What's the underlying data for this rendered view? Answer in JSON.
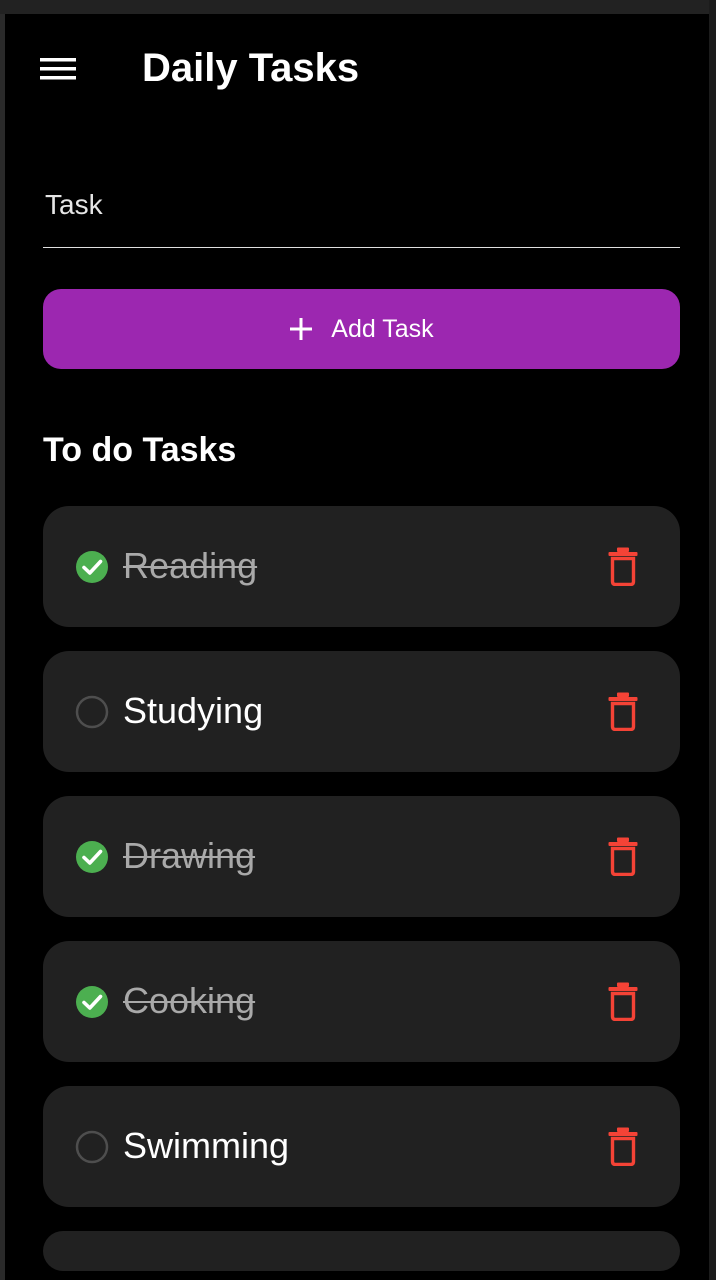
{
  "app": {
    "title": "Daily Tasks"
  },
  "form": {
    "task_placeholder": "Task",
    "add_label": "Add Task"
  },
  "section": {
    "title": "To do Tasks"
  },
  "tasks": [
    {
      "label": "Reading",
      "done": true
    },
    {
      "label": "Studying",
      "done": false
    },
    {
      "label": "Drawing",
      "done": true
    },
    {
      "label": "Cooking",
      "done": true
    },
    {
      "label": "Swimming",
      "done": false
    }
  ],
  "icons": {
    "menu": "menu-icon",
    "add": "plus-icon",
    "done": "check-circle-icon",
    "pending": "circle-outline-icon",
    "delete": "trash-icon"
  },
  "colors": {
    "accent": "#9c27b0",
    "done": "#4caf50",
    "delete": "#f44336",
    "card": "#212121",
    "background": "#000000"
  }
}
